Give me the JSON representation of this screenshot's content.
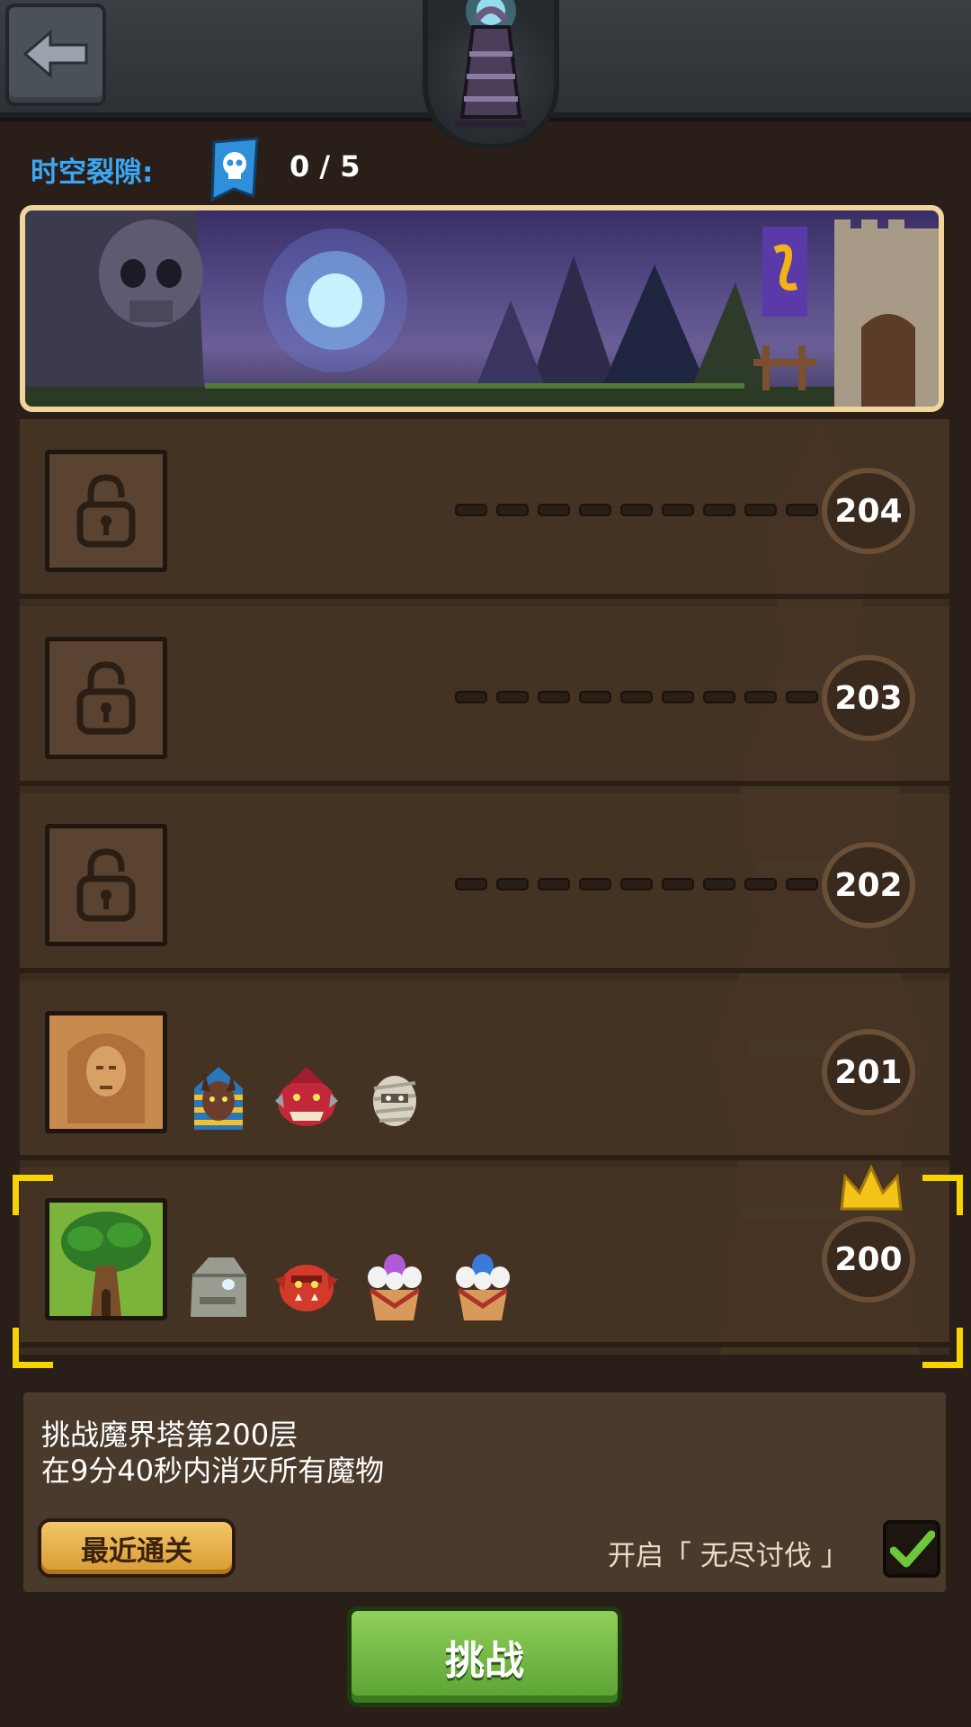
{
  "header": {
    "back_icon": "arrow-left-icon",
    "tower_icon": "demon-tower-icon"
  },
  "rift": {
    "label": "时空裂隙:",
    "icon": "skull-ticket-icon",
    "count": "0 / 5"
  },
  "banner": {
    "scene": "rift-portal-forest-castle"
  },
  "levels": [
    {
      "number": "204",
      "locked": true
    },
    {
      "number": "203",
      "locked": true
    },
    {
      "number": "202",
      "locked": true
    },
    {
      "number": "201",
      "locked": false,
      "monsters": [
        "pharaoh-jackal",
        "red-dragon-head",
        "mummy-head"
      ]
    },
    {
      "number": "200",
      "locked": false,
      "selected": true,
      "crowned": true,
      "monsters": [
        "stone-golem",
        "red-orc-head",
        "purple-crystal-plant",
        "blue-crystal-plant"
      ]
    }
  ],
  "info": {
    "line1": "挑战魔界塔第200层",
    "line2": "在9分40秒内消灭所有魔物",
    "recent_label": "最近通关",
    "endless_label": "开启「 无尽讨伐 」",
    "endless_checked": true
  },
  "challenge_label": "挑战",
  "colors": {
    "accent_blue": "#3aa7f2",
    "selection_yellow": "#f6d400",
    "challenge_green": "#6fbd3c",
    "recent_gold": "#e2a944"
  }
}
